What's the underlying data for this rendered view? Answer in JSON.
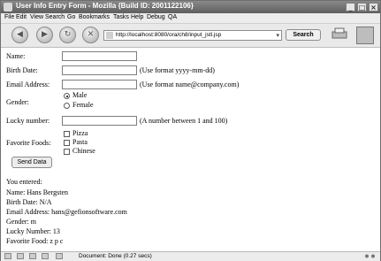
{
  "window": {
    "title": "User Info Entry Form - Mozilla {Build ID: 2001122106}",
    "controls": [
      "_",
      "□",
      "×"
    ]
  },
  "menu": [
    "File",
    "Edit",
    "View",
    "Search",
    "Go",
    "Bookmarks",
    "Tasks",
    "Help",
    "Debug",
    "QA"
  ],
  "toolbar": {
    "url": "http://localhost:8080/ora/ch8/input_jstl.jsp",
    "search_label": "Search"
  },
  "form": {
    "name_label": "Name:",
    "birth_label": "Birth Date:",
    "birth_hint": "(Use format yyyy-mm-dd)",
    "email_label": "Email Address:",
    "email_hint": "(Use format name@company.com)",
    "gender_label": "Gender:",
    "gender_options": [
      "Male",
      "Female"
    ],
    "gender_selected": "Male",
    "lucky_label": "Lucky number:",
    "lucky_hint": "(A number between 1 and 100)",
    "foods_label": "Favorite Foods:",
    "foods_options": [
      "Pizza",
      "Pasta",
      "Chinese"
    ],
    "send_label": "Send Data"
  },
  "results": {
    "heading": "You entered:",
    "lines": [
      "Name: Hans Bergsten",
      "Birth Date: N/A",
      "Email Address: hans@gefionsoftware.com",
      "Gender: m",
      "Lucky Number: 13",
      "Favorite Food: z p c"
    ]
  },
  "status": {
    "text": "Document: Done (0.27 secs)"
  }
}
